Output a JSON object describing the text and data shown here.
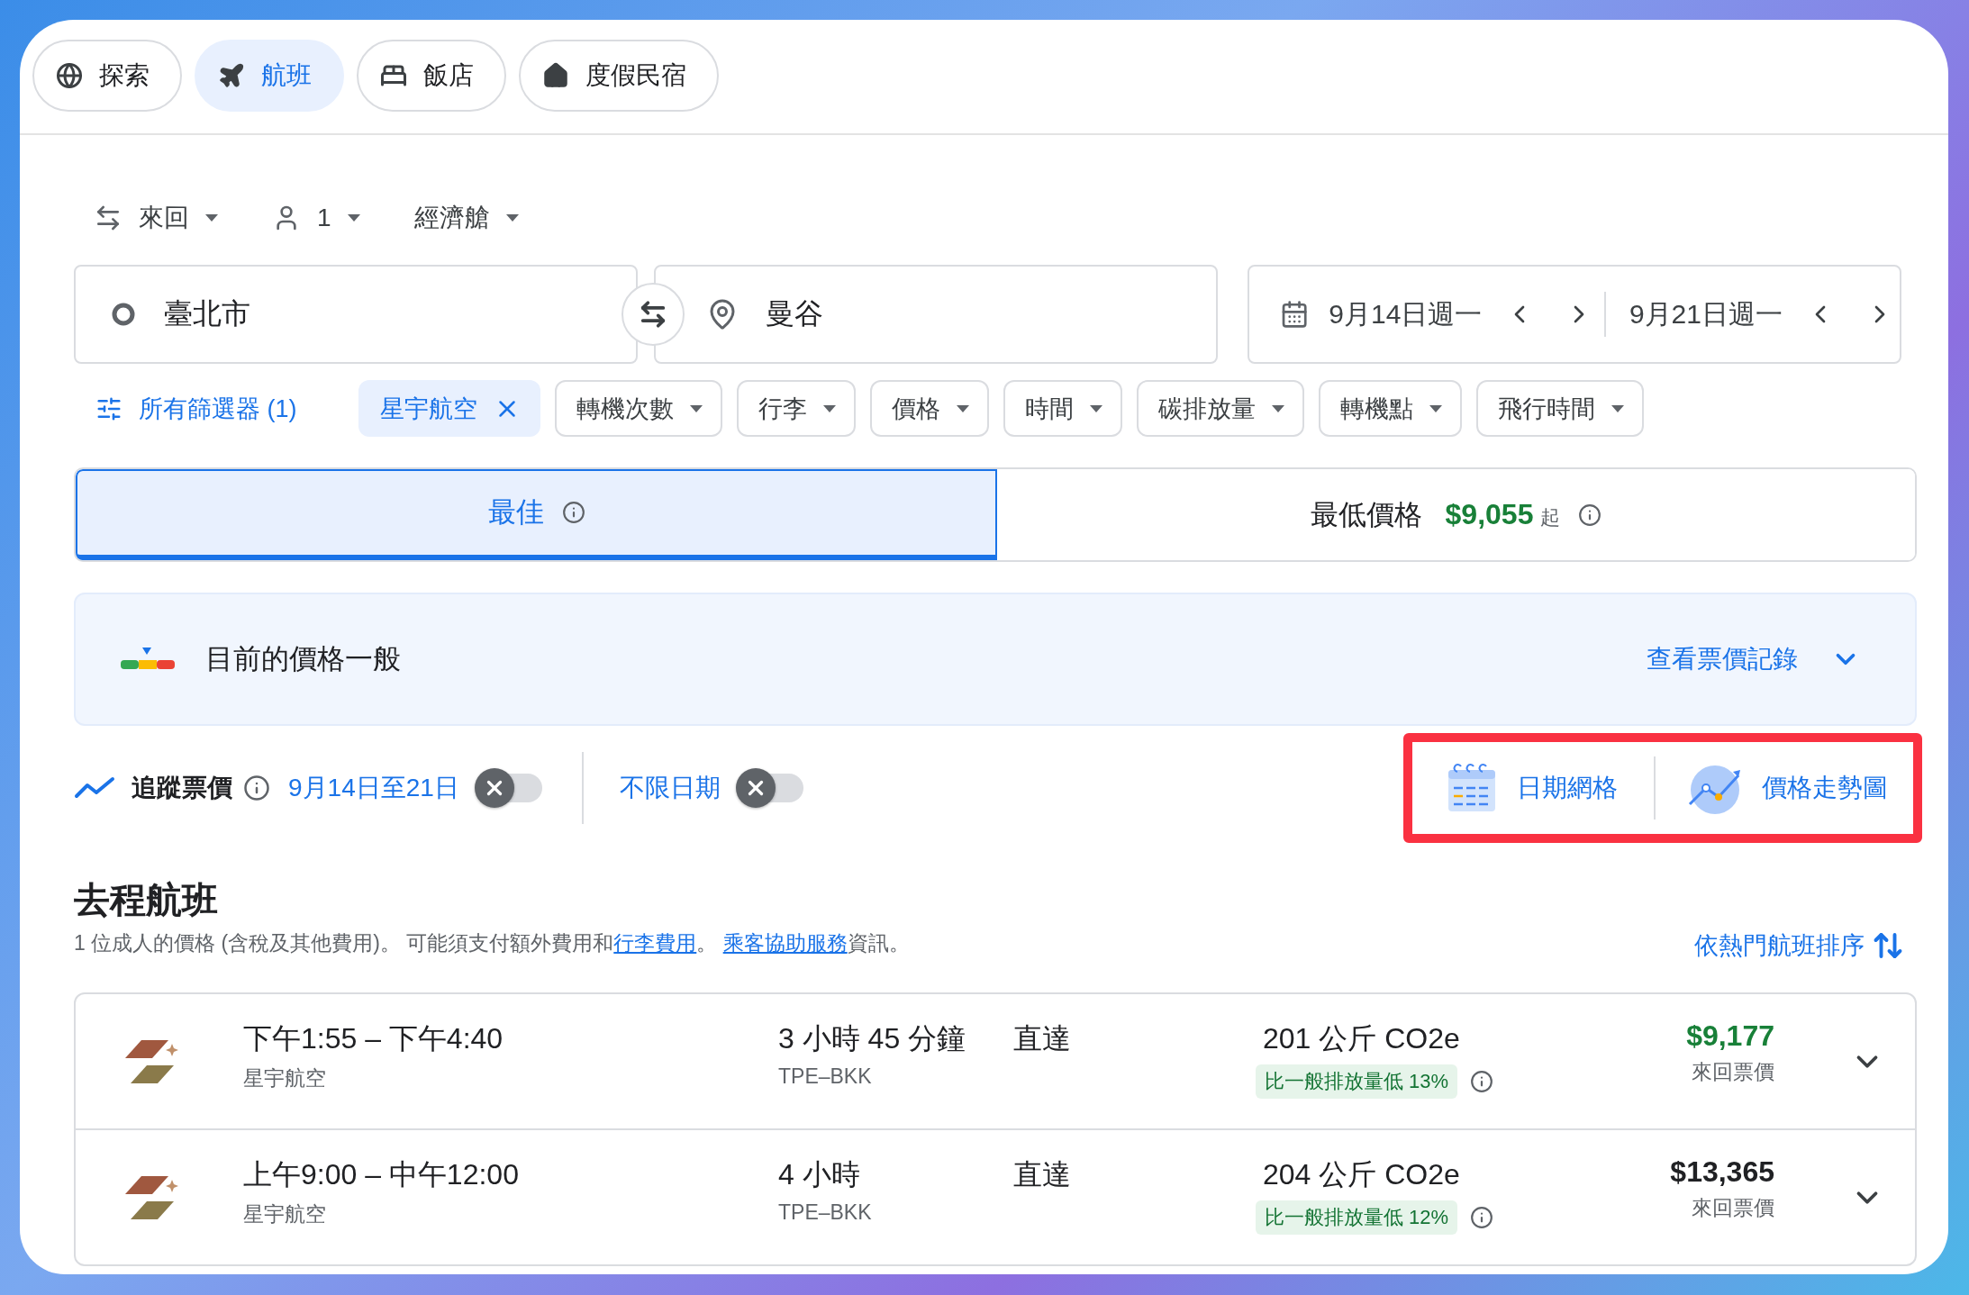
{
  "nav_tabs": [
    {
      "label": "探索",
      "selected": false
    },
    {
      "label": "航班",
      "selected": true
    },
    {
      "label": "飯店",
      "selected": false
    },
    {
      "label": "度假民宿",
      "selected": false
    }
  ],
  "trip_options": [
    {
      "label": "來回"
    },
    {
      "label": "1"
    },
    {
      "label": "經濟艙"
    }
  ],
  "origin": {
    "value": "臺北市"
  },
  "destination": {
    "value": "曼谷"
  },
  "dates": [
    {
      "value": "9月14日週一"
    },
    {
      "value": "9月21日週一"
    }
  ],
  "filters": [
    {
      "kind": "all",
      "label": "所有篩選器 (1)"
    },
    {
      "kind": "active",
      "label": "星宇航空"
    },
    {
      "kind": "dropdown",
      "label": "轉機次數"
    },
    {
      "kind": "dropdown",
      "label": "行李"
    },
    {
      "kind": "dropdown",
      "label": "價格"
    },
    {
      "kind": "dropdown",
      "label": "時間"
    },
    {
      "kind": "dropdown",
      "label": "碳排放量"
    },
    {
      "kind": "dropdown",
      "label": "轉機點"
    },
    {
      "kind": "dropdown",
      "label": "飛行時間"
    }
  ],
  "sort_tabs": [
    {
      "label": "最佳",
      "selected": true
    },
    {
      "label": "最低價格",
      "price": "$9,055",
      "suffix": "起",
      "selected": false
    }
  ],
  "price_insight": {
    "text": "目前的價格一般",
    "link": "查看票價記錄"
  },
  "tracking": {
    "label": "追蹤票價",
    "dates_label": "9月14日至21日",
    "dates_on": false,
    "any_dates_label": "不限日期",
    "any_dates_on": false
  },
  "tools_highlighted": true,
  "tools": [
    {
      "kind": "date_grid",
      "label": "日期網格"
    },
    {
      "kind": "price_graph",
      "label": "價格走勢圖"
    }
  ],
  "section": {
    "title": "去程航班",
    "sort_label": "依熱門航班排序",
    "note_parts": [
      {
        "kind": "text",
        "text": "1 位成人的價格 (含稅及其他費用)。 可能須支付額外費用和"
      },
      {
        "kind": "link",
        "text": "行李費用"
      },
      {
        "kind": "text",
        "text": "。 "
      },
      {
        "kind": "link",
        "text": "乘客協助服務"
      },
      {
        "kind": "text",
        "text": "資訊。"
      }
    ]
  },
  "flights": [
    {
      "times": "下午1:55 – 下午4:40",
      "airline": "星宇航空",
      "duration": "3 小時 45 分鐘",
      "route": "TPE–BKK",
      "stops": "直達",
      "emissions": "201 公斤 CO2e",
      "emissions_note": "比一般排放量低 13%",
      "price": "$9,177",
      "price_note": "來回票價",
      "best_price": true
    },
    {
      "times": "上午9:00 – 中午12:00",
      "airline": "星宇航空",
      "duration": "4 小時",
      "route": "TPE–BKK",
      "stops": "直達",
      "emissions": "204 公斤 CO2e",
      "emissions_note": "比一般排放量低 12%",
      "price": "$13,365",
      "price_note": "來回票價",
      "best_price": false
    }
  ]
}
